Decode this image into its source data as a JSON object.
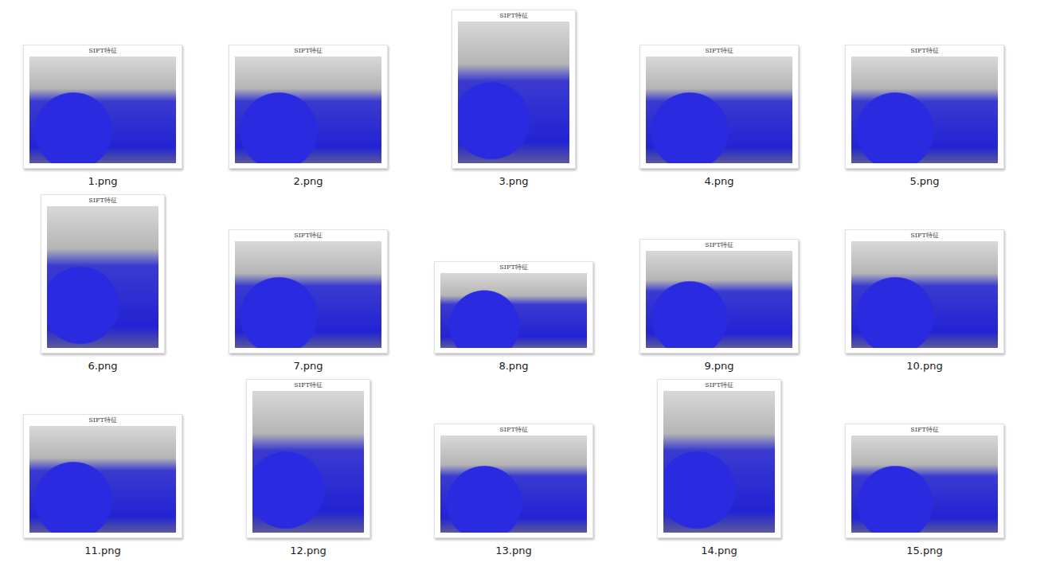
{
  "files": [
    {
      "name": "1.png",
      "title": "SIFT特征",
      "kind": "landscape"
    },
    {
      "name": "2.png",
      "title": "SIFT特征",
      "kind": "landscape"
    },
    {
      "name": "3.png",
      "title": "SIFT特征",
      "kind": "portrait"
    },
    {
      "name": "4.png",
      "title": "SIFT特征",
      "kind": "landscape"
    },
    {
      "name": "5.png",
      "title": "SIFT特征",
      "kind": "landscape"
    },
    {
      "name": "6.png",
      "title": "SIFT特征",
      "kind": "portrait"
    },
    {
      "name": "7.png",
      "title": "SIFT特征",
      "kind": "landscape"
    },
    {
      "name": "8.png",
      "title": "SIFT特征",
      "kind": "wide"
    },
    {
      "name": "9.png",
      "title": "SIFT特征",
      "kind": "short"
    },
    {
      "name": "10.png",
      "title": "SIFT特征",
      "kind": "landscape"
    },
    {
      "name": "11.png",
      "title": "SIFT特征",
      "kind": "landscape"
    },
    {
      "name": "12.png",
      "title": "SIFT特征",
      "kind": "portrait"
    },
    {
      "name": "13.png",
      "title": "SIFT特征",
      "kind": "short"
    },
    {
      "name": "14.png",
      "title": "SIFT特征",
      "kind": "portrait"
    },
    {
      "name": "15.png",
      "title": "SIFT特征",
      "kind": "short"
    }
  ]
}
